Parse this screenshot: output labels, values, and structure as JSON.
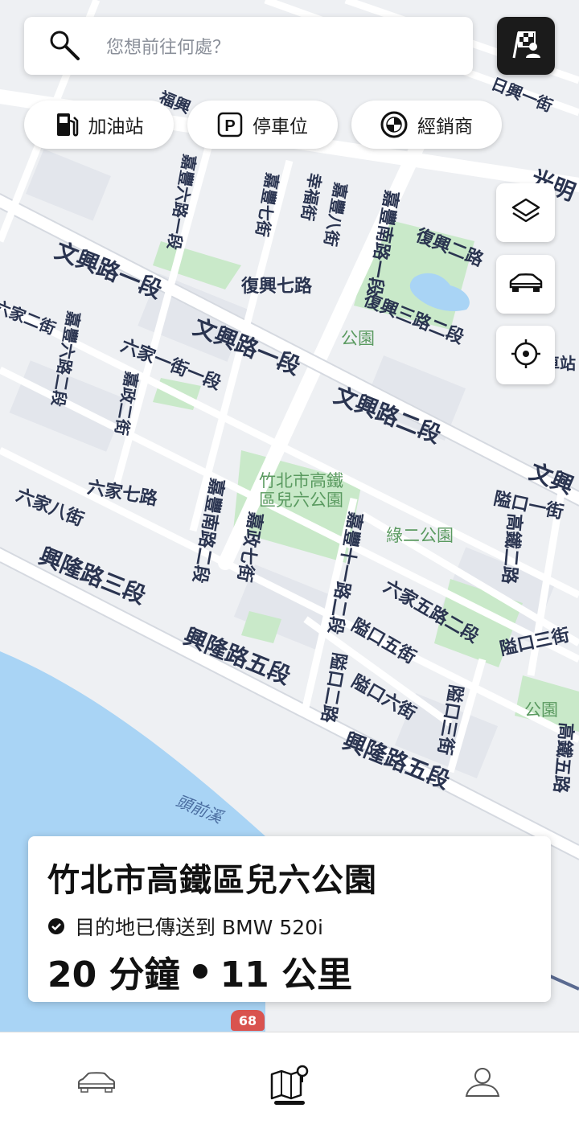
{
  "search": {
    "placeholder": "您想前往何處？"
  },
  "chips": [
    {
      "label": "加油站",
      "icon": "fuel-pump-icon"
    },
    {
      "label": "停車位",
      "icon": "parking-icon"
    },
    {
      "label": "經銷商",
      "icon": "bmw-logo-icon"
    }
  ],
  "map": {
    "labels": {
      "l01": "文興路一段",
      "l02": "文興路一段",
      "l03": "文興路二段",
      "l04": "興隆路三段",
      "l05": "興隆路五段",
      "l06": "興隆路五段",
      "l07": "復興七路",
      "l08": "復興二路",
      "l09": "復興三路二段",
      "l10": "六家一街一段",
      "l11": "六家七路",
      "l12": "六家八街",
      "l13": "六家五路二段",
      "l14": "嘉豐南路二段",
      "l15": "嘉政七街",
      "l16": "嘉豐十一路二段",
      "l17": "隘口一街",
      "l18": "隘口三街",
      "l19": "隘口五街",
      "l20": "隘口六街",
      "l21": "隘口二路",
      "l22": "隘口三街",
      "l23": "高鐵二路",
      "l24": "竹北市高鐵",
      "l25": "區兒六公園",
      "l26": "綠二公園",
      "l27": "公園",
      "l28": "公園",
      "l29": "頭前溪",
      "l30": "嘉豐七街",
      "l31": "幸福街",
      "l32": "嘉豐八街",
      "l33": "嘉豐南路一段",
      "l34": "嘉豐六路一段",
      "l35": "嘉豐六路二段",
      "l36": "嘉政二街",
      "l37": "六家二街",
      "l38": "日興一街",
      "l39": "光明",
      "l40": "文興",
      "l41": "高鐵五路",
      "l42": "福興",
      "l43": "車站",
      "l44": "68"
    }
  },
  "destination": {
    "title": "竹北市高鐵區兒六公園",
    "status": "目的地已傳送到 BMW 520i",
    "duration": "20 分鐘",
    "distance": "11 公里"
  },
  "colors": {
    "accent_dark": "#1b1b1b",
    "river": "#a9d4f5",
    "park": "#c9e9c9",
    "road": "#ffffff",
    "label": "#2a3450"
  }
}
